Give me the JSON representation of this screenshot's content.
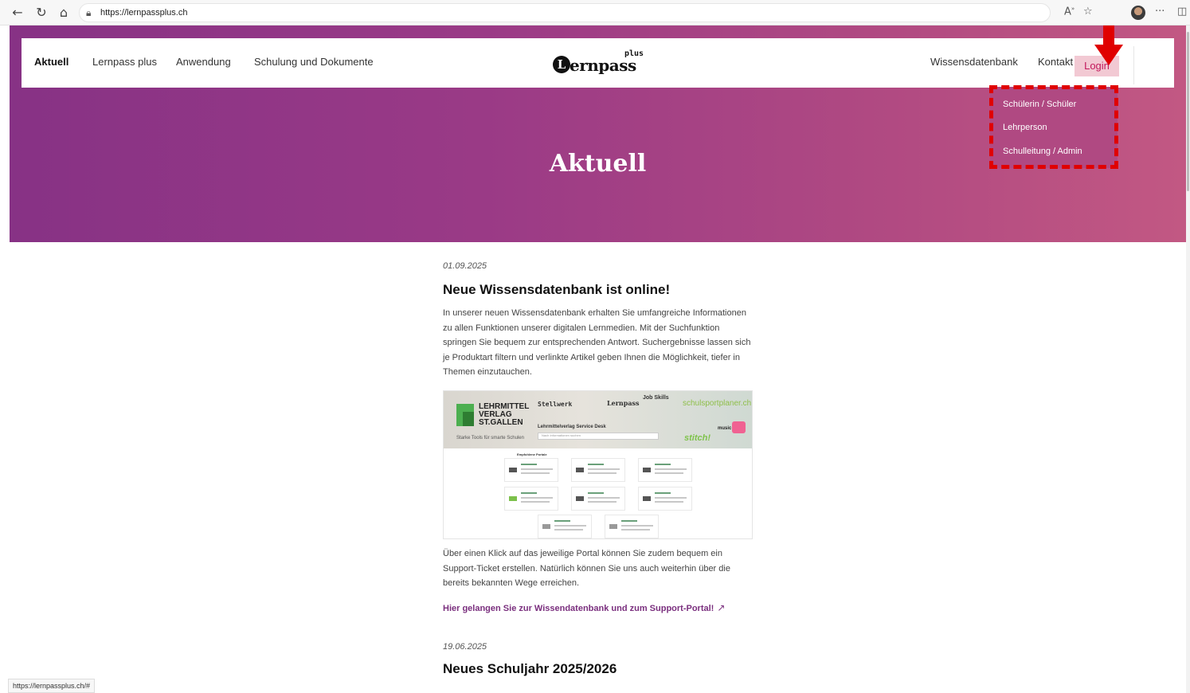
{
  "browser": {
    "url": "https://lernpassplus.ch",
    "status_url": "https://lernpassplus.ch/#"
  },
  "header": {
    "nav_left": [
      "Aktuell",
      "Lernpass plus",
      "Anwendung",
      "Schulung und Dokumente"
    ],
    "logo_letter": "L",
    "logo_text": "ernpass",
    "logo_plus": "plus",
    "nav_right": [
      "Wissensdatenbank",
      "Kontakt"
    ],
    "login_label": "Login"
  },
  "login_menu": {
    "items": [
      "Schülerin / Schüler",
      "Lehrperson",
      "Schulleitung / Admin"
    ]
  },
  "hero": {
    "title": "Aktuell"
  },
  "articles": [
    {
      "date": "01.09.2025",
      "title": "Neue Wissensdatenbank ist online!",
      "body": "In unserer neuen Wissensdatenbank erhalten Sie umfangreiche Informationen zu allen Funktionen unserer digitalen Lernmedien. Mit der Suchfunktion springen Sie bequem zur entsprechenden Antwort. Suchergebnisse lassen sich je Produktart filtern und verlinkte Artikel geben Ihnen die Möglichkeit, tiefer in Themen einzutauchen.",
      "body2": "Über einen Klick auf das jeweilige Portal können Sie zudem bequem ein Support-Ticket erstellen. Natürlich können Sie uns auch weiterhin über die bereits bekannten Wege erreichen.",
      "link": "Hier gelangen Sie zur Wissendatenbank und zum Support-Portal!"
    },
    {
      "date": "19.06.2025",
      "title": "Neues Schuljahr 2025/2026"
    }
  ],
  "thumbnail": {
    "publisher": "LEHRMITTEL VERLAG ST.GALLEN",
    "tagline": "Starke Tools für smarte Schulen",
    "desk_title": "Lehrmittelverlag Service Desk",
    "search_placeholder": "Nach Informationen suchen",
    "brands": [
      "Stellwerk",
      "Lernpass",
      "Job Skills",
      "schulsportplaner.ch",
      "music box",
      "stitch!"
    ],
    "portals_heading": "Empfohlene Portale"
  },
  "colors": {
    "hero_start": "#873285",
    "hero_end": "#c25883",
    "login_bg": "#f2c9d3",
    "login_text": "#c2185b",
    "link": "#7a2f7e",
    "highlight": "#e00000"
  }
}
